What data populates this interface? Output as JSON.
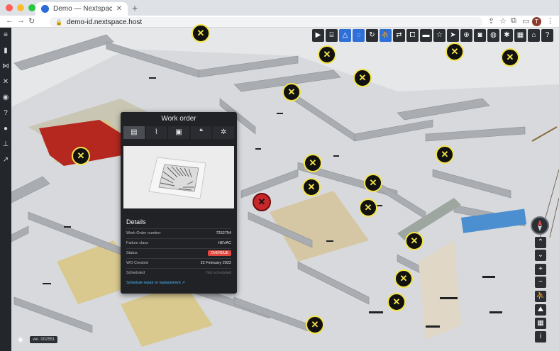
{
  "browser": {
    "tab_title": "Demo — Nextspace Navigator",
    "url": "demo-id.nextspace.host",
    "profile_initial": "T"
  },
  "toolbar": {
    "icons": [
      "play-icon",
      "easel-icon",
      "triangle-icon",
      "circle-icon",
      "rotate-icon",
      "walk-icon",
      "swap-icon",
      "crop-icon",
      "ruler-icon",
      "star-icon",
      "pointer-icon",
      "zoom-icon",
      "camera-icon",
      "globe-icon",
      "settings-icon",
      "keyboard-icon",
      "home-icon",
      "help-icon"
    ]
  },
  "panel": {
    "title": "Work order",
    "details_heading": "Details",
    "rows": [
      {
        "key": "Work Order number",
        "value": "7252754"
      },
      {
        "key": "Failure class",
        "value": "HEVAC"
      },
      {
        "key": "Status",
        "value": "OVERDUE"
      },
      {
        "key": "WO Created",
        "value": "22 February 2022"
      },
      {
        "key": "Scheduled",
        "value": "Not scheduled"
      }
    ],
    "link": "Schedule repair or replacement ↗"
  },
  "footer": {
    "version": "ver. 002551"
  },
  "colors": {
    "accent": "#2f6fd8",
    "marker_yellow": "#f3e44a",
    "alert_red": "#c8282a",
    "overdue_badge": "#e2473e",
    "link_blue": "#4dc0ff"
  }
}
